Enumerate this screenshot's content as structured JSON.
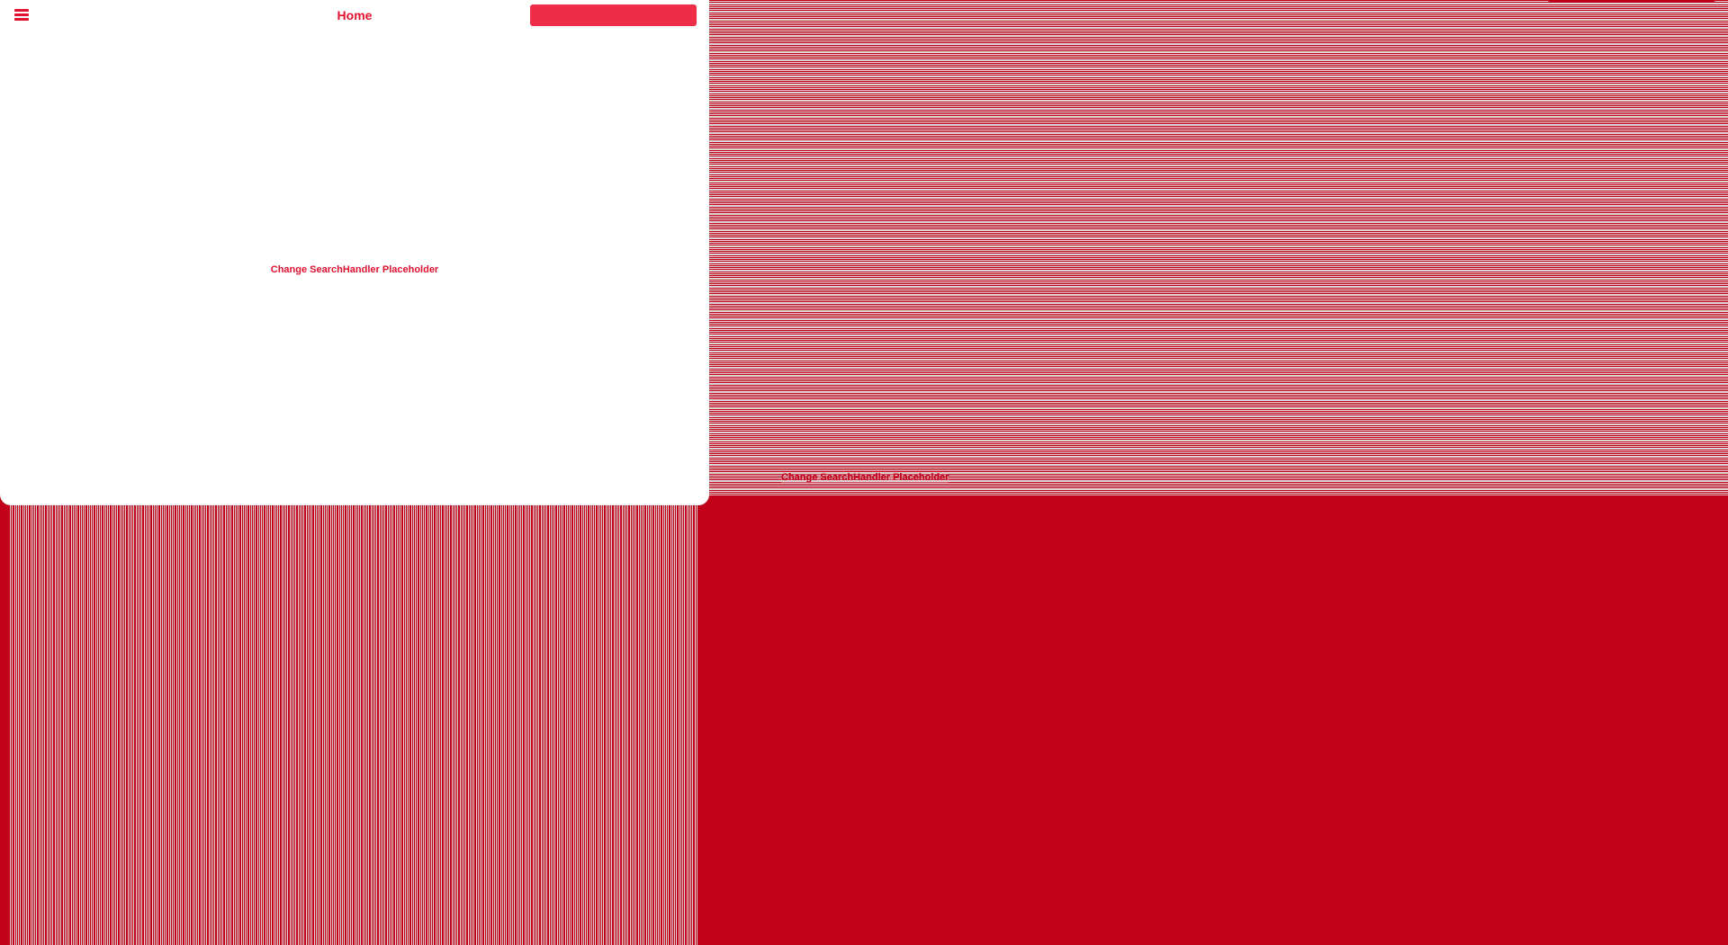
{
  "header": {
    "title": "Home",
    "search": {
      "value": "",
      "placeholder": ""
    }
  },
  "main": {
    "placeholder_text": "Change SearchHandler Placeholder"
  },
  "background": {
    "duplicate_placeholder_text": "Change SearchHandler Placeholder"
  },
  "colors": {
    "accent": "#e0102e",
    "background": "#c10019",
    "search_fill": "#ee2d48",
    "panel": "#ffffff"
  },
  "icons": {
    "menu": "hamburger-menu-icon"
  }
}
